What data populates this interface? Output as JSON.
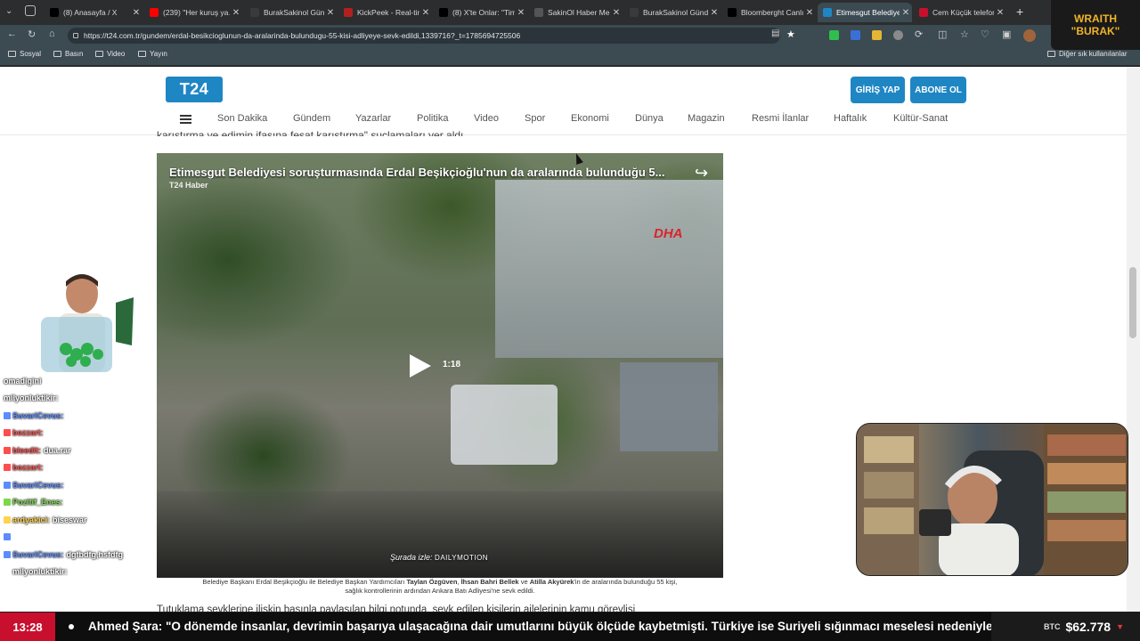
{
  "browser": {
    "tabs": [
      {
        "title": "(8) Anasayfa / X",
        "icon": "x-logo-icon",
        "color": "#000000",
        "active": false
      },
      {
        "title": "(239) \"Her kuruş ya…",
        "icon": "youtube-icon",
        "color": "#ff0000",
        "active": false
      },
      {
        "title": "BurakSakinol Günde…",
        "icon": "kick-icon",
        "color": "#3a3a3a",
        "active": false
      },
      {
        "title": "KickPeek - Real-time…",
        "icon": "kickpeek-icon",
        "color": "#b32020",
        "active": false
      },
      {
        "title": "(8) X'te Onlar: \"Tim…",
        "icon": "x-logo-icon",
        "color": "#000000",
        "active": false
      },
      {
        "title": "SakinOl Haber Merk…",
        "icon": "globe-icon",
        "color": "#555555",
        "active": false
      },
      {
        "title": "BurakSakinol Günde…",
        "icon": "kick-icon",
        "color": "#3a3a3a",
        "active": false
      },
      {
        "title": "Bloomberght Canlı…",
        "icon": "bloomberg-icon",
        "color": "#000000",
        "active": false
      },
      {
        "title": "Etimesgut Belediye…",
        "icon": "t24-icon",
        "color": "#1f86c4",
        "active": true
      },
      {
        "title": "Cem Küçük telefon…",
        "icon": "news-icon",
        "color": "#c8102e",
        "active": false
      }
    ],
    "url": "https://t24.com.tr/gundem/erdal-besikcioglunun-da-aralarinda-bulundugu-55-kisi-adliyeye-sevk-edildi,1339716?_t=1785694725506",
    "bookmarks": [
      "Sosyal",
      "Basın",
      "Video",
      "Yayın"
    ],
    "other_bookmarks": "Diğer sık kullanılanlar"
  },
  "site": {
    "logo": "T24",
    "login_button": "GİRİŞ YAP",
    "subscribe_button": "ABONE OL",
    "nav": [
      "Son Dakika",
      "Gündem",
      "Yazarlar",
      "Politika",
      "Video",
      "Spor",
      "Ekonomi",
      "Dünya",
      "Magazin",
      "Resmi İlanlar",
      "Haftalık",
      "Kültür-Sanat"
    ],
    "accent": "#1f86c4"
  },
  "article": {
    "partial_text": "karıştırma ve edimin ifasına fesat karıştırma\" suçlamaları yer aldı.",
    "video": {
      "title": "Etimesgut Belediyesi soruşturmasında Erdal Beşikçioğlu'nun da aralarında bulunduğu 5...",
      "source": "T24 Haber",
      "duration": "1:18",
      "watch_on_prefix": "Şurada izle:",
      "watch_on_brand": "DAILYMOTION",
      "watermark": "DHA"
    },
    "caption": {
      "p1": "Belediye Başkanı Erdal Beşikçioğlu ile Belediye Başkan Yardımcıları ",
      "b1": "Taylan Özgüven",
      "p2": ", ",
      "b2": "İhsan Bahri Bellek",
      "p3": " ve ",
      "b3": "Atilla Akyürek",
      "p4": "'in de aralarında bulunduğu 55 kişi,",
      "line2": "sağlık kontrollerinin ardından Ankara Batı Adliyesi'ne sevk edildi."
    },
    "next_paragraph": "Tutuklama sevklerine ilişkin basınla paylaşılan bilgi notunda, sevk edilen kişilerin ailelerinin kamu görevlisi"
  },
  "overlay": {
    "badge": {
      "line1": "WRAITH",
      "line2": "\"BURAK\""
    },
    "chat": [
      {
        "user": "omadigini",
        "msg": "",
        "color": "#ffffff"
      },
      {
        "user": "milyonluktikir:",
        "msg": "",
        "color": "#ffffff"
      },
      {
        "user": "SuvariCevus:",
        "msg": "",
        "color": "#5c8cff"
      },
      {
        "user": "bozzart:",
        "msg": "",
        "color": "#ff4d4d"
      },
      {
        "user": "bleedit:",
        "msg": "dua.rar",
        "color": "#ff4d4d"
      },
      {
        "user": "bozzart:",
        "msg": "",
        "color": "#ff4d4d"
      },
      {
        "user": "SuvariCevus:",
        "msg": "",
        "color": "#5c8cff"
      },
      {
        "user": "Pozitif_Enes:",
        "msg": "",
        "color": "#7cd84a"
      },
      {
        "user": "ardyakici:",
        "msg": "biseswar",
        "color": "#ffd34d"
      },
      {
        "user": "",
        "msg": "",
        "color": "#5c8cff"
      },
      {
        "user": "SuvariCevus:",
        "msg": "dgfbdfg,hsfdfg",
        "color": "#5c8cff"
      },
      {
        "user": "milyonluktikir:",
        "msg": "",
        "color": "#ffffff"
      }
    ]
  },
  "ticker": {
    "time": "13:28",
    "headline": "Ahmed Şara: \"O dönemde insanlar, devrimin başarıya ulaşacağına dair umutlarını büyük ölçüde kaybetmişti. Türkiye ise Suriyeli sığınmacı meselesi nedeniyle",
    "btc_label": "BTC",
    "btc_value": "$62.778",
    "btc_trend": "▼",
    "trend_color": "#e53935"
  }
}
